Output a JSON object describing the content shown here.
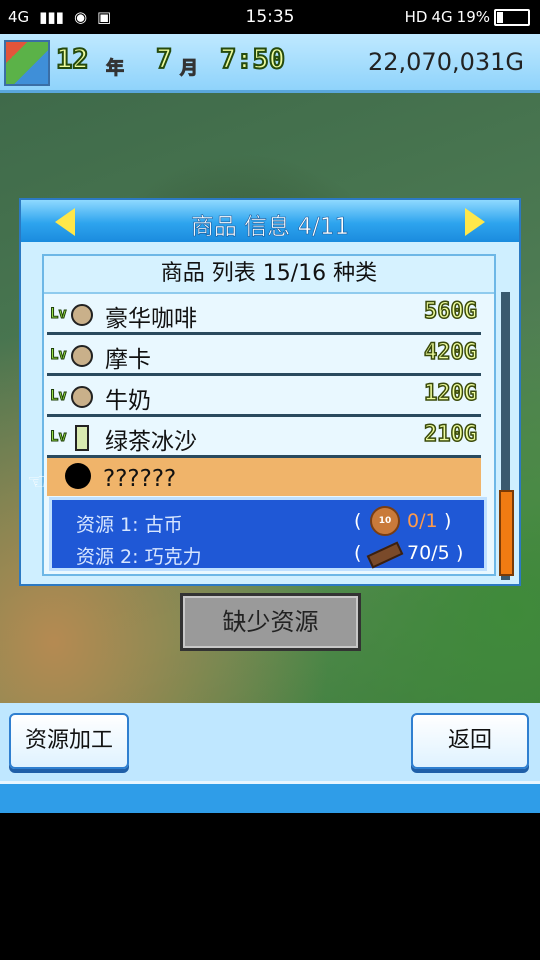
{
  "status_bar": {
    "network": "4G",
    "time": "15:35",
    "hd": "HD",
    "lte": "4G",
    "battery_percent": "19%",
    "battery_level": 0.19
  },
  "hud": {
    "year": "12",
    "year_unit": "年",
    "month": "7",
    "month_unit": "月",
    "clock": "7:50",
    "money": "22,070,031G"
  },
  "panel": {
    "title": "商品 信息 4/11",
    "list_header": "商品 列表 15/16 种类",
    "items": [
      {
        "name": "豪华咖啡",
        "price": "560G",
        "lv": "Lv",
        "icon": "coffee-cup-icon"
      },
      {
        "name": "摩卡",
        "price": "420G",
        "lv": "Lv",
        "icon": "coffee-cup-icon"
      },
      {
        "name": "牛奶",
        "price": "120G",
        "lv": "Lv",
        "icon": "coffee-cup-icon"
      },
      {
        "name": "绿茶冰沙",
        "price": "210G",
        "lv": "Lv",
        "icon": "bottle-icon"
      }
    ],
    "locked_item": {
      "name": "??????"
    },
    "resources": [
      {
        "label": "资源 1: 古币",
        "value": "0/1",
        "status": "insufficient",
        "icon": "coin-icon",
        "coin_text": "10"
      },
      {
        "label": "资源 2: 巧克力",
        "value": "70/5",
        "status": "ok",
        "icon": "chocolate-icon"
      }
    ],
    "paren_open": "(",
    "paren_close": ")"
  },
  "buttons": {
    "missing_resources": "缺少资源",
    "resource_processing": "资源加工",
    "back": "返回"
  }
}
